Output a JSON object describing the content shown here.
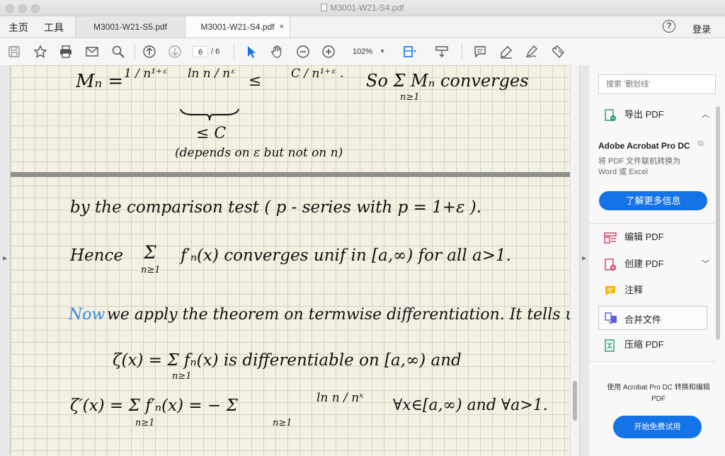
{
  "window": {
    "title": "M3001-W21-S4.pdf"
  },
  "nav": {
    "home": "主页",
    "tools": "工具",
    "login": "登录",
    "help": "?"
  },
  "tabs": [
    {
      "label": "M3001-W21-S5.pdf",
      "active": false
    },
    {
      "label": "M3001-W21-S4.pdf",
      "active": true,
      "close": "×"
    }
  ],
  "toolbar": {
    "page_current": "6",
    "page_total": "/ 6",
    "zoom": "102%",
    "icons": [
      "save-icon",
      "bookmark-star-icon",
      "print-icon",
      "email-icon",
      "search-zoom-icon",
      "page-up-icon",
      "page-down-icon",
      "select-cursor-icon",
      "hand-icon",
      "zoom-out-icon",
      "zoom-in-icon",
      "fit-page-icon",
      "scroll-mode-icon",
      "comment-icon",
      "highlight-icon",
      "sign-icon",
      "fill-sign-icon"
    ]
  },
  "document": {
    "line1_mn": "Mₙ =",
    "line1_frac1": "1 / n¹⁺ᵋ",
    "line1_frac2": "ln n / nᵋ",
    "line1_le": "≤",
    "line1_frac3": "C / n¹⁺ᵋ .",
    "line1_so": "So  Σ Mₙ converges",
    "line1_sum_sub": "n≥1",
    "brace_le_c": "≤ C",
    "brace_note": "(depends on ε but not on n)",
    "line2": "by the comparison test  ( p - series with  p = 1+ε ).",
    "line3_hence": "Hence",
    "line3_sum": "Σ",
    "line3_sub": "n≥1",
    "line3_rest": "f′ₙ(x)  converges unif  in  [a,∞)  for all  a>1.",
    "line4_now": "Now",
    "line4_rest": "we apply the theorem on termwise differentiation. It tells us:",
    "line5": "ζ(x) =  Σ  fₙ(x)   is   differentiable  on  [a,∞)  and",
    "line5_sub": "n≥1",
    "line6_lhs": "ζ′(x) =  Σ  f′ₙ(x) =  −  Σ",
    "line6_sub1": "n≥1",
    "line6_sub2": "n≥1",
    "line6_frac": "ln n / nˣ",
    "line6_rhs": "∀x∈[a,∞)  and  ∀a>1."
  },
  "panel": {
    "search_placeholder": "搜索 '删划线'",
    "export": "导出 PDF",
    "promo_title": "Adobe Acrobat Pro DC",
    "promo_text": "将 PDF 文件联机转换为 Word 或 Excel",
    "learn_more": "了解更多信息",
    "edit": "编辑 PDF",
    "create": "创建 PDF",
    "comment": "注释",
    "merge": "合并文件",
    "compress": "压缩 PDF",
    "bottom_text": "使用 Acrobat Pro DC 转换和编辑 PDF",
    "trial": "开始免费试用"
  },
  "colors": {
    "accent": "#1473e6",
    "paper": "#f4f1e2",
    "grid": "#cfd3c8",
    "ink_blue": "#2f86e0"
  }
}
